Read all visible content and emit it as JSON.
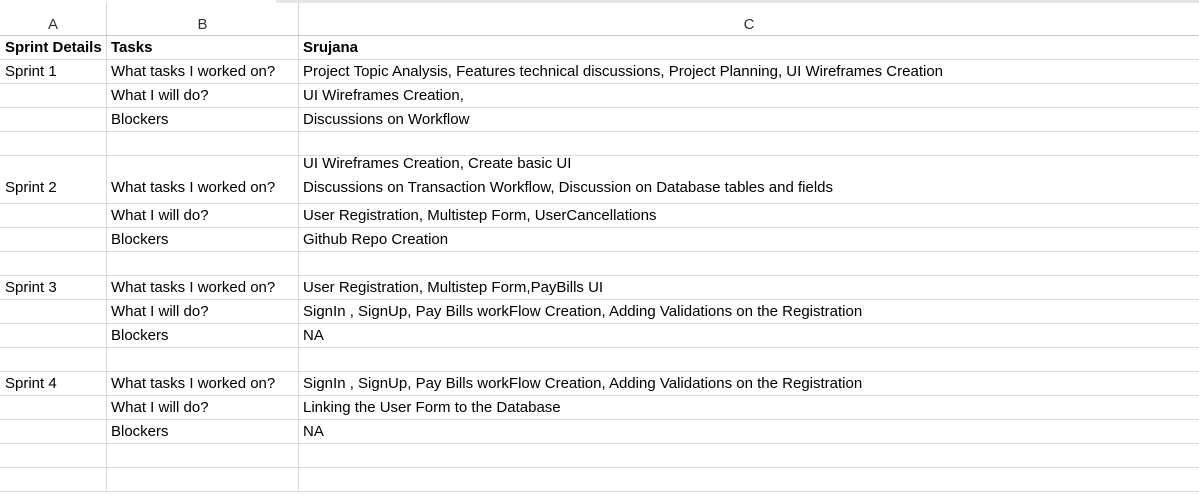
{
  "columns": [
    "A",
    "B",
    "C"
  ],
  "header": {
    "a": "Sprint Details",
    "b": "Tasks",
    "c": "Srujana"
  },
  "rows": [
    {
      "a": "Sprint 1",
      "b": "What tasks I worked on?",
      "c": "Project Topic Analysis, Features technical discussions, Project Planning, UI Wireframes Creation"
    },
    {
      "a": "",
      "b": "What I will do?",
      "c": "UI Wireframes Creation,"
    },
    {
      "a": "",
      "b": "Blockers",
      "c": "Discussions on Workflow"
    },
    {
      "a": "",
      "b": "",
      "c": ""
    },
    {
      "a": "Sprint 2",
      "b": "What tasks I worked on?",
      "c1": "UI Wireframes Creation, Create basic UI",
      "c2": "Discussions on Transaction Workflow, Discussion on Database tables and fields"
    },
    {
      "a": "",
      "b": "What I will do?",
      "c": "User Registration, Multistep Form, UserCancellations"
    },
    {
      "a": "",
      "b": "Blockers",
      "c": "Github Repo Creation"
    },
    {
      "a": "",
      "b": "",
      "c": ""
    },
    {
      "a": "Sprint 3",
      "b": "What tasks I worked on?",
      "c": "User Registration, Multistep Form,PayBills UI"
    },
    {
      "a": "",
      "b": "What I will do?",
      "c": "SignIn , SignUp, Pay Bills workFlow Creation, Adding Validations on the Registration"
    },
    {
      "a": "",
      "b": "Blockers",
      "c": "NA"
    },
    {
      "a": "",
      "b": "",
      "c": ""
    },
    {
      "a": "Sprint 4",
      "b": "What tasks I worked on?",
      "c": "SignIn , SignUp, Pay Bills workFlow Creation, Adding Validations on the Registration"
    },
    {
      "a": "",
      "b": "What I will do?",
      "c": "Linking the User Form to the Database"
    },
    {
      "a": "",
      "b": "Blockers",
      "c": "NA"
    },
    {
      "a": "",
      "b": "",
      "c": ""
    },
    {
      "a": "",
      "b": "",
      "c": ""
    }
  ]
}
